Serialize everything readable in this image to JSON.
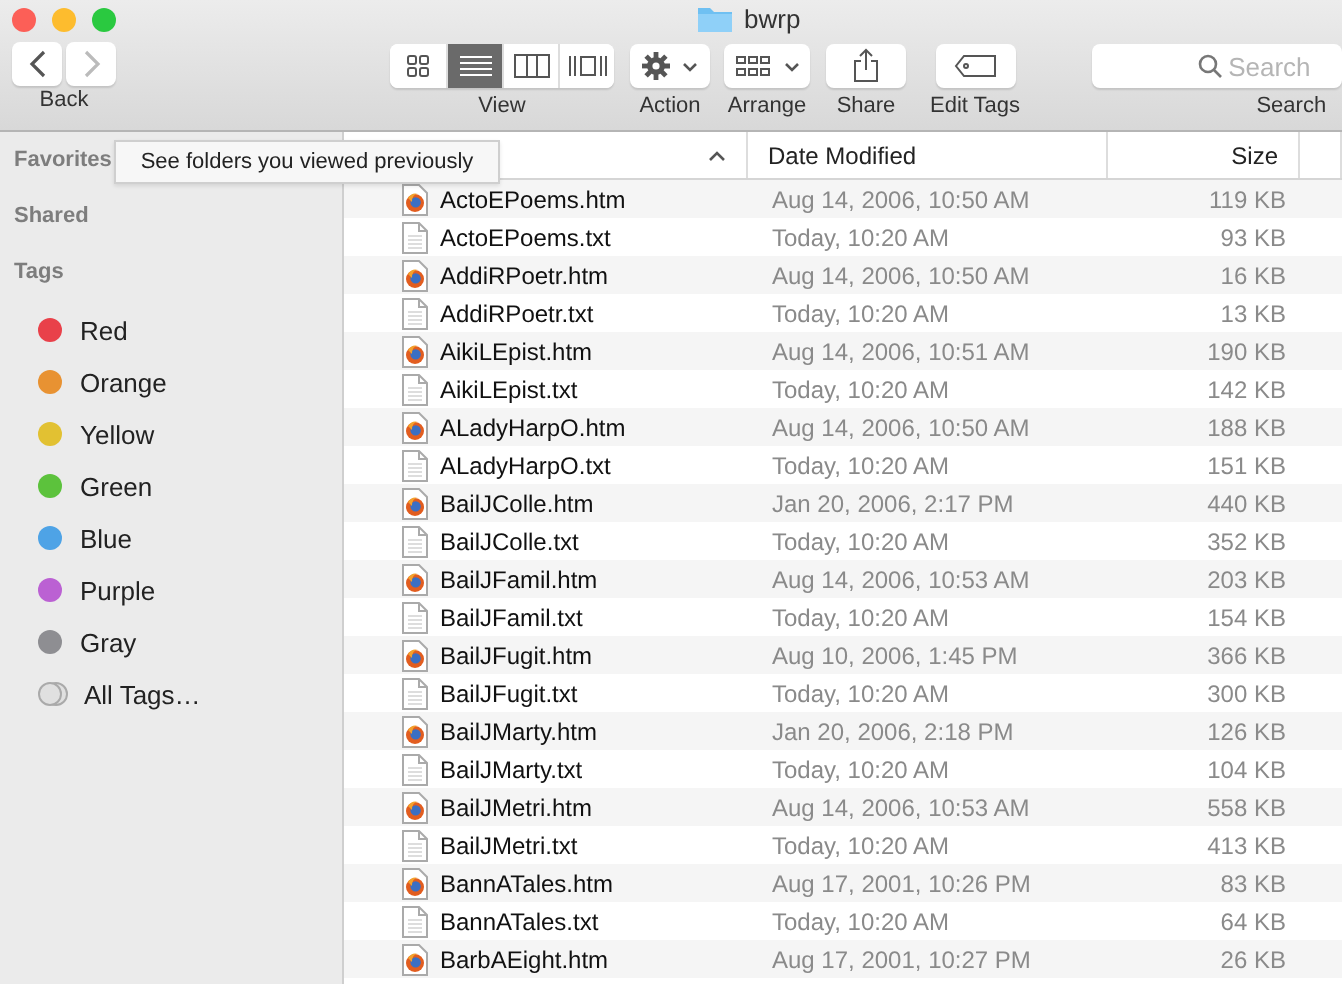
{
  "window": {
    "title": "bwrp"
  },
  "toolbar": {
    "back_label": "Back",
    "view": {
      "label": "View",
      "modes": [
        {
          "kind": "icons",
          "selected": false
        },
        {
          "kind": "list",
          "selected": true
        },
        {
          "kind": "columns",
          "selected": false
        },
        {
          "kind": "coverflow",
          "selected": false
        }
      ]
    },
    "tools": [
      {
        "kind": "action",
        "label": "Action"
      },
      {
        "kind": "arrange",
        "label": "Arrange"
      },
      {
        "kind": "share",
        "label": "Share"
      },
      {
        "kind": "tags",
        "label": "Edit Tags"
      }
    ],
    "search": {
      "placeholder": "Search",
      "label": "Search"
    }
  },
  "tooltip": "See folders you viewed previously",
  "sidebar": {
    "sections": [
      "Favorites",
      "Shared",
      "Tags"
    ],
    "tags": [
      {
        "label": "Red",
        "kind": "color",
        "color": "#e9414a"
      },
      {
        "label": "Orange",
        "kind": "color",
        "color": "#e89232"
      },
      {
        "label": "Yellow",
        "kind": "color",
        "color": "#e2c132"
      },
      {
        "label": "Green",
        "kind": "color",
        "color": "#5cc23c"
      },
      {
        "label": "Blue",
        "kind": "color",
        "color": "#4ea3e6"
      },
      {
        "label": "Purple",
        "kind": "color",
        "color": "#bb61d3"
      },
      {
        "label": "Gray",
        "kind": "color",
        "color": "#8e8e92"
      },
      {
        "label": "All Tags…",
        "kind": "all"
      }
    ]
  },
  "table": {
    "columns": [
      "Date Modified",
      "Size"
    ],
    "rows": [
      {
        "kind": "web",
        "name": "ActoEPoems.htm",
        "date": "Aug 14, 2006, 10:50 AM",
        "size": "119 KB"
      },
      {
        "kind": "text",
        "name": "ActoEPoems.txt",
        "date": "Today, 10:20 AM",
        "size": "93 KB"
      },
      {
        "kind": "web",
        "name": "AddiRPoetr.htm",
        "date": "Aug 14, 2006, 10:50 AM",
        "size": "16 KB"
      },
      {
        "kind": "text",
        "name": "AddiRPoetr.txt",
        "date": "Today, 10:20 AM",
        "size": "13 KB"
      },
      {
        "kind": "web",
        "name": "AikiLEpist.htm",
        "date": "Aug 14, 2006, 10:51 AM",
        "size": "190 KB"
      },
      {
        "kind": "text",
        "name": "AikiLEpist.txt",
        "date": "Today, 10:20 AM",
        "size": "142 KB"
      },
      {
        "kind": "web",
        "name": "ALadyHarpO.htm",
        "date": "Aug 14, 2006, 10:50 AM",
        "size": "188 KB"
      },
      {
        "kind": "text",
        "name": "ALadyHarpO.txt",
        "date": "Today, 10:20 AM",
        "size": "151 KB"
      },
      {
        "kind": "web",
        "name": "BailJColle.htm",
        "date": "Jan 20, 2006, 2:17 PM",
        "size": "440 KB"
      },
      {
        "kind": "text",
        "name": "BailJColle.txt",
        "date": "Today, 10:20 AM",
        "size": "352 KB"
      },
      {
        "kind": "web",
        "name": "BailJFamil.htm",
        "date": "Aug 14, 2006, 10:53 AM",
        "size": "203 KB"
      },
      {
        "kind": "text",
        "name": "BailJFamil.txt",
        "date": "Today, 10:20 AM",
        "size": "154 KB"
      },
      {
        "kind": "web",
        "name": "BailJFugit.htm",
        "date": "Aug 10, 2006, 1:45 PM",
        "size": "366 KB"
      },
      {
        "kind": "text",
        "name": "BailJFugit.txt",
        "date": "Today, 10:20 AM",
        "size": "300 KB"
      },
      {
        "kind": "web",
        "name": "BailJMarty.htm",
        "date": "Jan 20, 2006, 2:18 PM",
        "size": "126 KB"
      },
      {
        "kind": "text",
        "name": "BailJMarty.txt",
        "date": "Today, 10:20 AM",
        "size": "104 KB"
      },
      {
        "kind": "web",
        "name": "BailJMetri.htm",
        "date": "Aug 14, 2006, 10:53 AM",
        "size": "558 KB"
      },
      {
        "kind": "text",
        "name": "BailJMetri.txt",
        "date": "Today, 10:20 AM",
        "size": "413 KB"
      },
      {
        "kind": "web",
        "name": "BannATales.htm",
        "date": "Aug 17, 2001, 10:26 PM",
        "size": "83 KB"
      },
      {
        "kind": "text",
        "name": "BannATales.txt",
        "date": "Today, 10:20 AM",
        "size": "64 KB"
      },
      {
        "kind": "web",
        "name": "BarbAEight.htm",
        "date": "Aug 17, 2001, 10:27 PM",
        "size": "26 KB"
      }
    ]
  }
}
